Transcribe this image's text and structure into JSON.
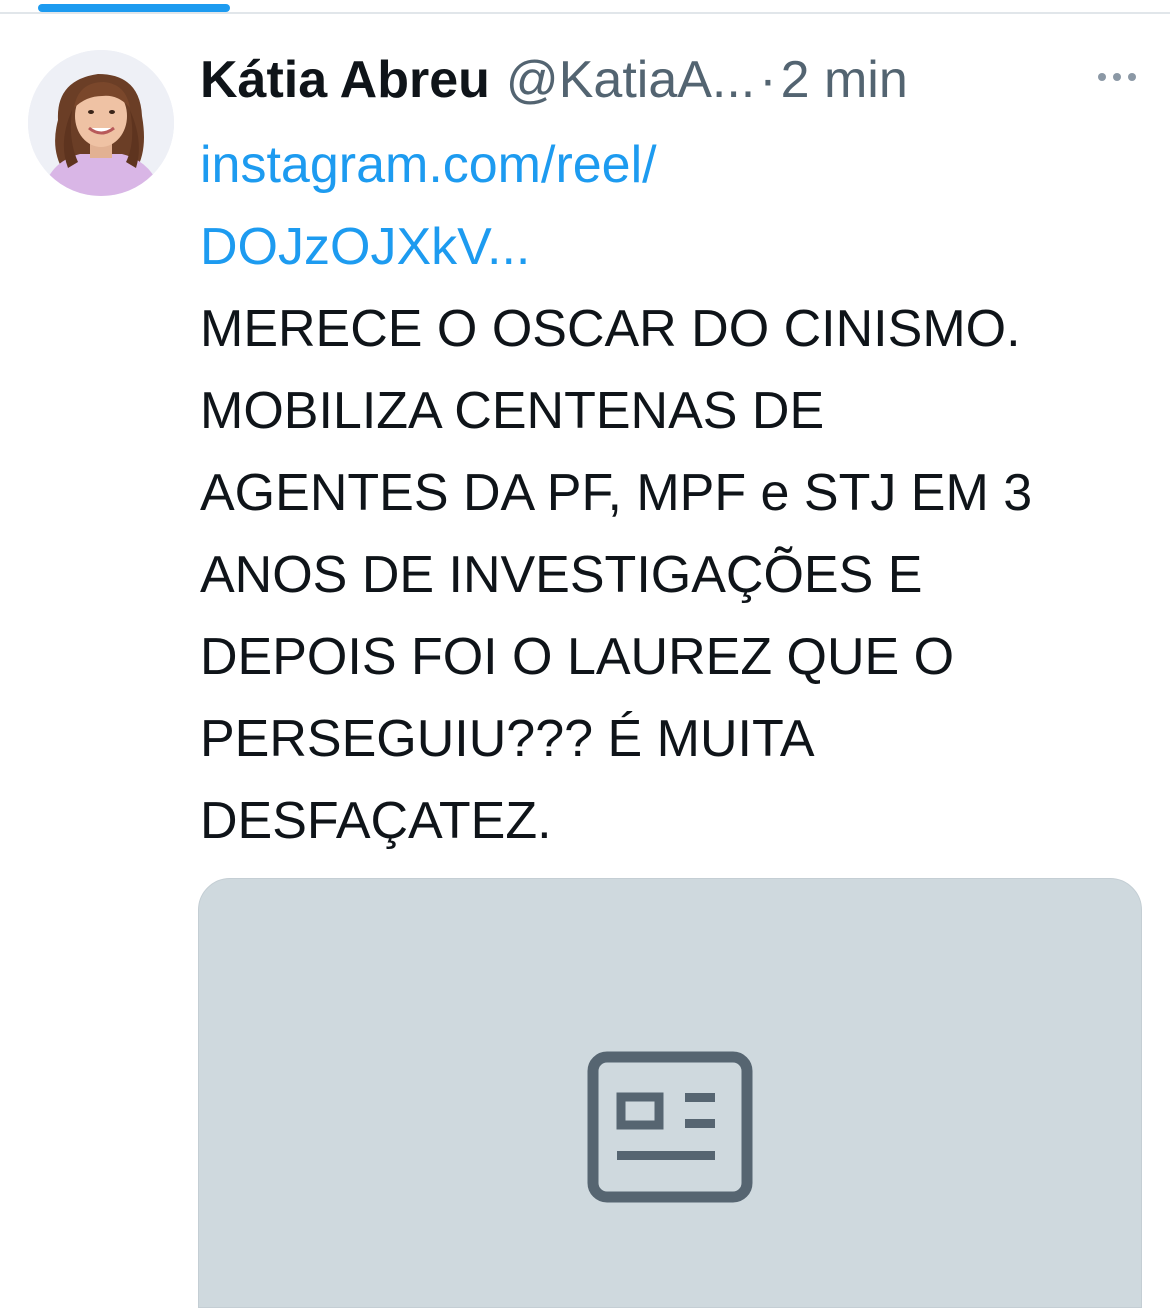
{
  "tweet": {
    "author_name": "Kátia Abreu",
    "handle": "@KatiaA...",
    "separator": "·",
    "time": "2 min",
    "link_line1": "instagram.com/reel/",
    "link_line2": "DOJzOJXkV...",
    "text": "MERECE O OSCAR DO CINISMO.\nMOBILIZA CENTENAS DE\nAGENTES DA PF, MPF e STJ EM 3\nANOS DE INVESTIGAÇÕES E\nDEPOIS FOI O LAUREZ QUE O\nPERSEGUIU??? É MUITA\nDESFAÇATEZ."
  },
  "icons": {
    "more": "more-horizontal-icon",
    "card_placeholder": "article-icon"
  },
  "colors": {
    "link": "#1d9bf0",
    "secondary_text": "#536471",
    "card_background": "#cfd9de",
    "card_icon": "#566571"
  }
}
